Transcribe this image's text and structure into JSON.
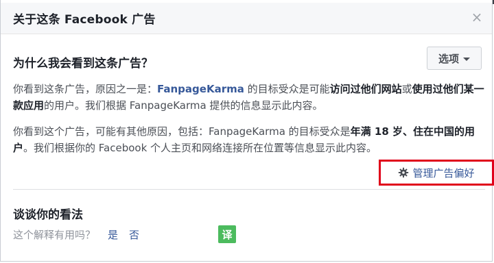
{
  "dialog": {
    "title": "关于这条 Facebook 广告",
    "close_icon": "close-icon"
  },
  "why": {
    "title": "为什么我会看到这条广告？",
    "options_label": "选项"
  },
  "reason1": {
    "t1": "你看到这条广告，原因之一是：",
    "page": "FanpageKarma",
    "t2": " 的目标受众是可能",
    "b1": "访问过他们网站",
    "t3": "或",
    "b2": "使用过他们某一款应用",
    "t4": "的用户。我们根据 FanpageKarma 提供的信息显示此内容。"
  },
  "reason2": {
    "t1": "你看到这个广告，可能有其他原因，包括：FanpageKarma 的目标受众是",
    "b1": "年满 18 岁、住在中国的用户",
    "t2": "。我们根据你的 Facebook 个人主页和网络连接所在位置等信息显示此内容。"
  },
  "manage": {
    "label": "管理广告偏好",
    "icon": "gear-icon"
  },
  "feedback": {
    "title": "谈谈你的看法",
    "question": "这个解释有用吗？",
    "yes": "是",
    "no": "否",
    "translate": "译"
  },
  "colors": {
    "link": "#365899",
    "highlight_box": "#e0001a",
    "translate_bg": "#4cbb5e"
  }
}
